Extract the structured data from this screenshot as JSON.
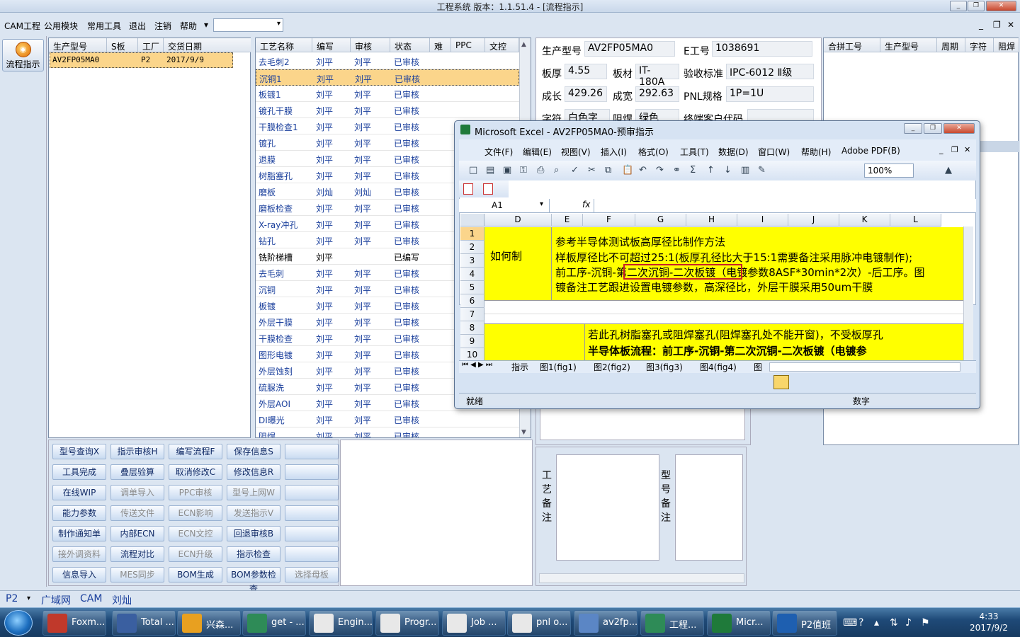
{
  "window": {
    "title": "工程系统   版本：1.1.51.4 - [流程指示]",
    "minimize": "_",
    "restore": "❐",
    "close": "✕"
  },
  "menu": {
    "items": [
      "CAM工程",
      "公用模块",
      "常用工具",
      "退出",
      "注销",
      "帮助"
    ],
    "help_arrow": "▾"
  },
  "sidebar": {
    "flow_button": "流程指示"
  },
  "order_table": {
    "headers": [
      "生产型号",
      "S板",
      "工厂",
      "交货日期"
    ],
    "rows": [
      {
        "model": "AV2FP05MA0",
        "s": "",
        "factory": "P2",
        "date": "2017/9/9"
      }
    ]
  },
  "process_table": {
    "headers": [
      "工艺名称",
      "编写",
      "审核",
      "状态",
      "难",
      "PPC",
      "文控"
    ],
    "rows": [
      {
        "name": "去毛刺2",
        "writer": "刘平",
        "reviewer": "刘平",
        "status": "已审核"
      },
      {
        "name": "沉铜1",
        "writer": "刘平",
        "reviewer": "刘平",
        "status": "已审核",
        "selected": true
      },
      {
        "name": "板镀1",
        "writer": "刘平",
        "reviewer": "刘平",
        "status": "已审核"
      },
      {
        "name": "镀孔干膜",
        "writer": "刘平",
        "reviewer": "刘平",
        "status": "已审核"
      },
      {
        "name": "干膜检查1",
        "writer": "刘平",
        "reviewer": "刘平",
        "status": "已审核"
      },
      {
        "name": "镀孔",
        "writer": "刘平",
        "reviewer": "刘平",
        "status": "已审核"
      },
      {
        "name": "退膜",
        "writer": "刘平",
        "reviewer": "刘平",
        "status": "已审核"
      },
      {
        "name": "树脂塞孔",
        "writer": "刘平",
        "reviewer": "刘平",
        "status": "已审核"
      },
      {
        "name": "磨板",
        "writer": "刘灿",
        "reviewer": "刘灿",
        "status": "已审核"
      },
      {
        "name": "磨板检查",
        "writer": "刘平",
        "reviewer": "刘平",
        "status": "已审核"
      },
      {
        "name": "X-ray冲孔",
        "writer": "刘平",
        "reviewer": "刘平",
        "status": "已审核"
      },
      {
        "name": "钻孔",
        "writer": "刘平",
        "reviewer": "刘平",
        "status": "已审核"
      },
      {
        "name": "铣阶梯槽",
        "writer": "刘平",
        "reviewer": "",
        "status": "已编写",
        "black": true
      },
      {
        "name": "去毛刺",
        "writer": "刘平",
        "reviewer": "刘平",
        "status": "已审核"
      },
      {
        "name": "沉铜",
        "writer": "刘平",
        "reviewer": "刘平",
        "status": "已审核"
      },
      {
        "name": "板镀",
        "writer": "刘平",
        "reviewer": "刘平",
        "status": "已审核"
      },
      {
        "name": "外层干膜",
        "writer": "刘平",
        "reviewer": "刘平",
        "status": "已审核"
      },
      {
        "name": "干膜检查",
        "writer": "刘平",
        "reviewer": "刘平",
        "status": "已审核"
      },
      {
        "name": "图形电镀",
        "writer": "刘平",
        "reviewer": "刘平",
        "status": "已审核"
      },
      {
        "name": "外层蚀刻",
        "writer": "刘平",
        "reviewer": "刘平",
        "status": "已审核"
      },
      {
        "name": "硫脲洗",
        "writer": "刘平",
        "reviewer": "刘平",
        "status": "已审核"
      },
      {
        "name": "外层AOI",
        "writer": "刘平",
        "reviewer": "刘平",
        "status": "已审核"
      },
      {
        "name": "DI曝光",
        "writer": "刘平",
        "reviewer": "刘平",
        "status": "已审核"
      },
      {
        "name": "阻焊",
        "writer": "刘平",
        "reviewer": "刘平",
        "status": "已审核"
      }
    ]
  },
  "action_buttons": [
    {
      "label": "型号查询X",
      "enabled": true
    },
    {
      "label": "指示审核H",
      "enabled": true
    },
    {
      "label": "编写流程F",
      "enabled": true
    },
    {
      "label": "保存信息S",
      "enabled": true
    },
    {
      "label": "",
      "enabled": true
    },
    {
      "label": "工具完成",
      "enabled": true
    },
    {
      "label": "叠层验算",
      "enabled": true
    },
    {
      "label": "取消修改C",
      "enabled": true
    },
    {
      "label": "修改信息R",
      "enabled": true
    },
    {
      "label": "",
      "enabled": true
    },
    {
      "label": "在线WIP",
      "enabled": true
    },
    {
      "label": "调单导入",
      "enabled": false
    },
    {
      "label": "PPC审核",
      "enabled": false
    },
    {
      "label": "型号上网W",
      "enabled": false
    },
    {
      "label": "",
      "enabled": true
    },
    {
      "label": "能力参数",
      "enabled": true
    },
    {
      "label": "传送文件",
      "enabled": false
    },
    {
      "label": "ECN影响",
      "enabled": false
    },
    {
      "label": "发送指示V",
      "enabled": false
    },
    {
      "label": "",
      "enabled": true
    },
    {
      "label": "制作通知单",
      "enabled": true
    },
    {
      "label": "内部ECN",
      "enabled": true
    },
    {
      "label": "ECN文控",
      "enabled": false
    },
    {
      "label": "回退审核B",
      "enabled": true
    },
    {
      "label": "",
      "enabled": true
    },
    {
      "label": "接外调资料",
      "enabled": false
    },
    {
      "label": "流程对比",
      "enabled": true
    },
    {
      "label": "ECN升级",
      "enabled": false
    },
    {
      "label": "指示检查",
      "enabled": true
    },
    {
      "label": "",
      "enabled": true
    },
    {
      "label": "信息导入",
      "enabled": true
    },
    {
      "label": "MES同步",
      "enabled": false
    },
    {
      "label": "BOM生成",
      "enabled": true
    },
    {
      "label": "BOM参数检查",
      "enabled": true
    },
    {
      "label": "选择母板",
      "enabled": false
    }
  ],
  "info": {
    "model_label": "生产型号",
    "model": "AV2FP05MA0",
    "eno_label": "E工号",
    "eno": "1038691",
    "thick_label": "板厚",
    "thick": "4.55",
    "mat_label": "板材",
    "mat": "IT-180A",
    "std_label": "验收标准",
    "std": "IPC-6012 Ⅱ级",
    "len_label": "成长",
    "len": "429.26",
    "wid_label": "成宽",
    "wid": "292.63",
    "pnl_label": "PNL规格",
    "pnl": "1P=1U",
    "char_label": "字符",
    "char": "白色字符",
    "mask_label": "阻焊",
    "mask": "绿色",
    "cust_label": "终端客户代码"
  },
  "right_table": {
    "headers": [
      "合拼工号",
      "生产型号",
      "周期",
      "字符",
      "阻焊"
    ]
  },
  "notes": {
    "process_label": "工艺备注",
    "model_label": "型号备注"
  },
  "excel": {
    "title": "Microsoft Excel - AV2FP05MA0-预审指示",
    "menu": [
      "文件(F)",
      "编辑(E)",
      "视图(V)",
      "插入(I)",
      "格式(O)",
      "工具(T)",
      "数据(D)",
      "窗口(W)",
      "帮助(H)",
      "Adobe PDF(B)"
    ],
    "name_box": "A1",
    "fx": "fx",
    "zoom": "100%",
    "columns": [
      "D",
      "E",
      "F",
      "G",
      "H",
      "I",
      "J",
      "K",
      "L"
    ],
    "rows": [
      "1",
      "2",
      "3",
      "4",
      "5",
      "6",
      "7",
      "8",
      "9",
      "10"
    ],
    "label_cell": "如何制",
    "lines": [
      "参考半导体测试板高厚径比制作方法",
      "样板厚径比不可超过25:1(板厚孔径比大于15:1需要备注采用脉冲电镀制作);",
      "前工序-沉铜-第二次沉铜-二次板镀（电镀参数8ASF*30min*2次）-后工序。图",
      "镀备注工艺跟进设置电镀参数，高深径比，外层干膜采用50um干膜"
    ],
    "line8": "若此孔树脂塞孔或阻焊塞孔(阻焊塞孔处不能开窗)，不受板厚孔",
    "line9": "半导体板流程：前工序-沉铜-第二次沉铜-二次板镀（电镀参",
    "tabs": [
      "指示",
      "图1(fig1)",
      "图2(fig2)",
      "图3(fig3)",
      "图4(fig4)",
      "图"
    ],
    "status": "就绪",
    "status_num": "数字"
  },
  "statusbar": {
    "items": [
      "P2",
      "广域网",
      "CAM",
      "刘灿"
    ]
  },
  "taskbar": {
    "items": [
      {
        "label": "Foxm...",
        "color": "#c0392b"
      },
      {
        "label": "Total ...",
        "color": "#3a5fa0"
      },
      {
        "label": "兴森...",
        "color": "#e8a020"
      },
      {
        "label": "get - ...",
        "color": "#2e8b57"
      },
      {
        "label": "Engin...",
        "color": "#e8e8e8"
      },
      {
        "label": "Progr...",
        "color": "#e8e8e8"
      },
      {
        "label": "Job ...",
        "color": "#e8e8e8"
      },
      {
        "label": "pnl o...",
        "color": "#e8e8e8"
      },
      {
        "label": "av2fp...",
        "color": "#5b86c5"
      },
      {
        "label": "工程...",
        "color": "#2e8b57"
      },
      {
        "label": "Micr...",
        "color": "#1f7a3a"
      },
      {
        "label": "P2值班",
        "color": "#1e5fb0"
      }
    ],
    "time": "4:33",
    "date": "2017/9/2"
  }
}
